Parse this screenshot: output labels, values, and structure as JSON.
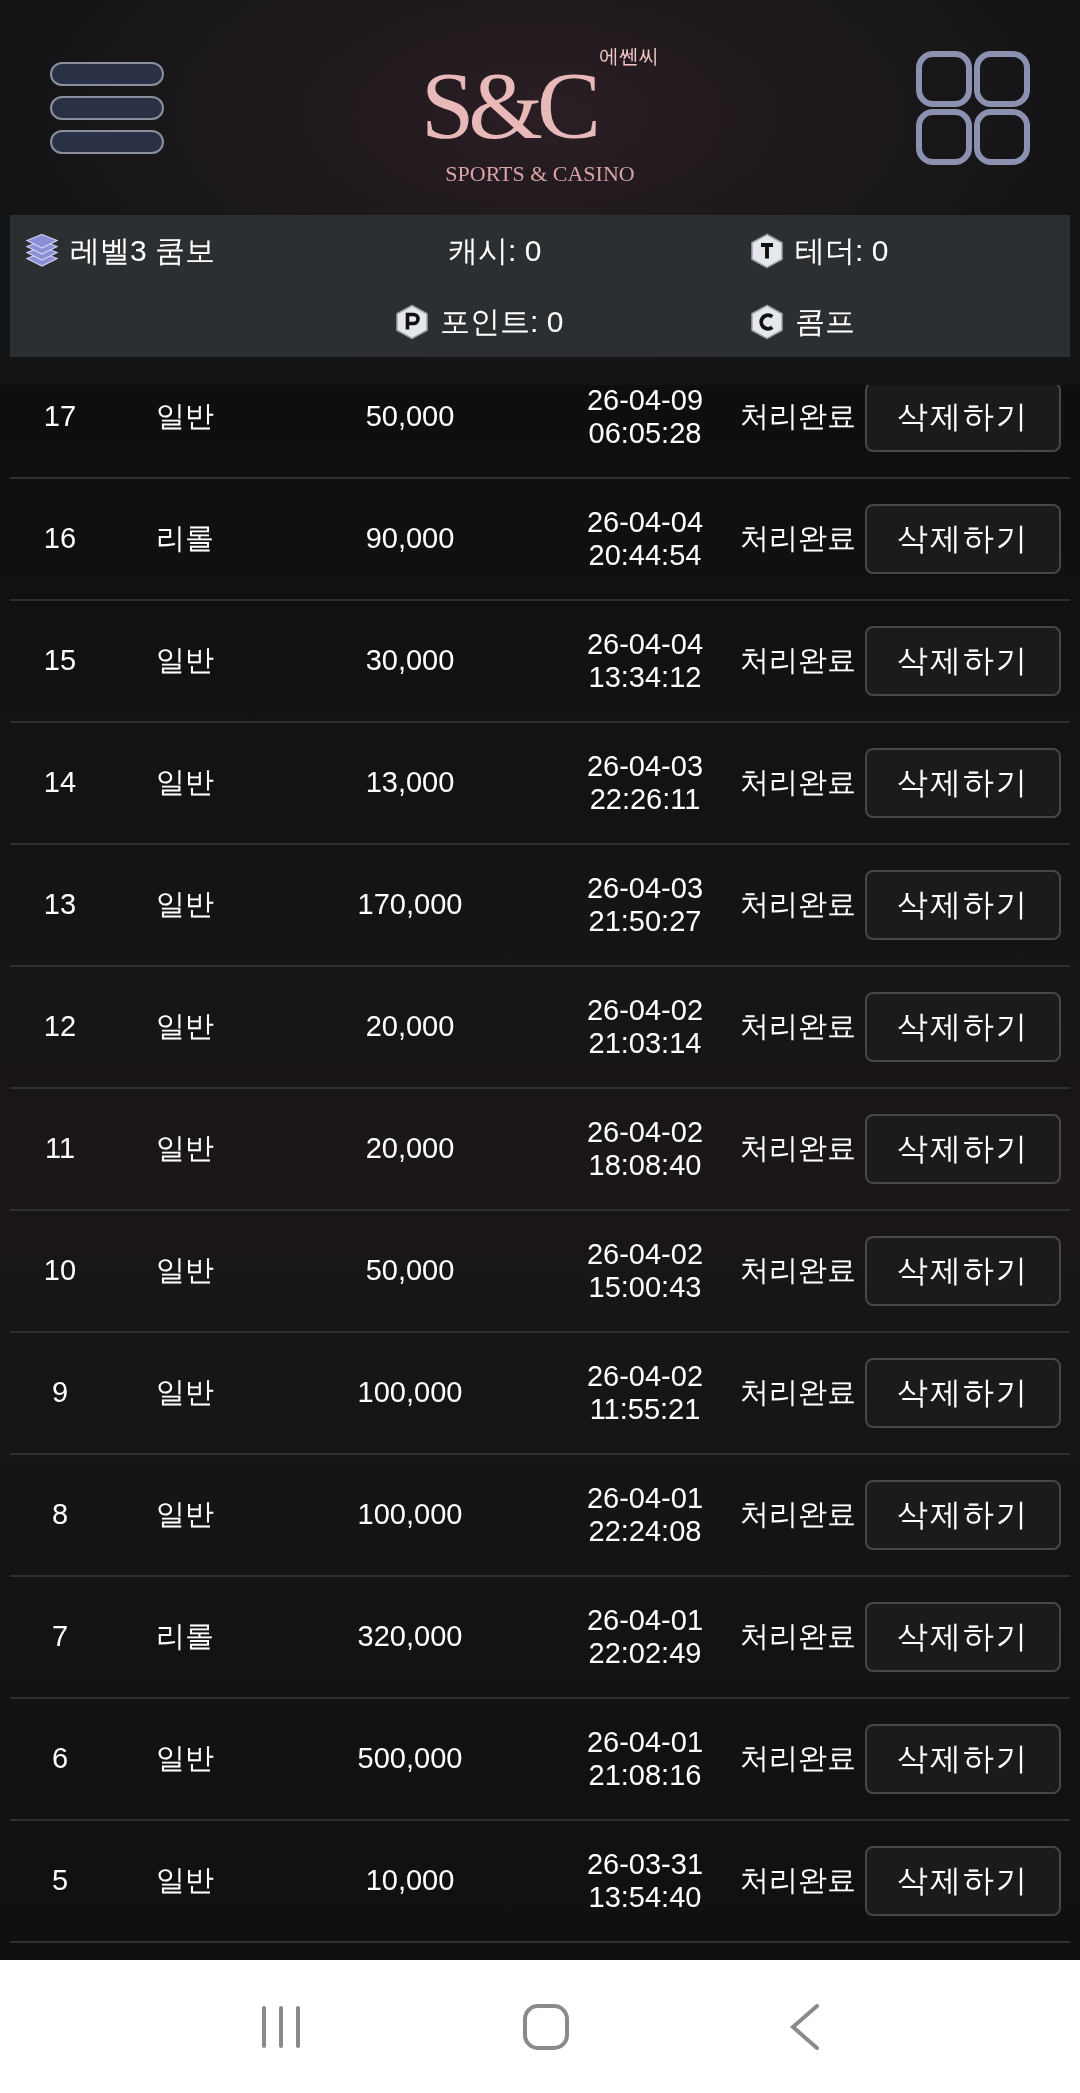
{
  "logo": {
    "mark": "S&C",
    "korean": "에쎈씨",
    "tagline": "SPORTS & CASINO"
  },
  "info": {
    "level": "레벨3 쿰보",
    "cash": "캐시: 0",
    "tether": "테더: 0",
    "point": "포인트: 0",
    "comp": "콤프"
  },
  "rows": [
    {
      "no": "17",
      "type": "일반",
      "amount": "50,000",
      "date": "26-04-09",
      "time": "06:05:28",
      "status": "처리완료",
      "action": "삭제하기"
    },
    {
      "no": "16",
      "type": "리롤",
      "amount": "90,000",
      "date": "26-04-04",
      "time": "20:44:54",
      "status": "처리완료",
      "action": "삭제하기"
    },
    {
      "no": "15",
      "type": "일반",
      "amount": "30,000",
      "date": "26-04-04",
      "time": "13:34:12",
      "status": "처리완료",
      "action": "삭제하기"
    },
    {
      "no": "14",
      "type": "일반",
      "amount": "13,000",
      "date": "26-04-03",
      "time": "22:26:11",
      "status": "처리완료",
      "action": "삭제하기"
    },
    {
      "no": "13",
      "type": "일반",
      "amount": "170,000",
      "date": "26-04-03",
      "time": "21:50:27",
      "status": "처리완료",
      "action": "삭제하기"
    },
    {
      "no": "12",
      "type": "일반",
      "amount": "20,000",
      "date": "26-04-02",
      "time": "21:03:14",
      "status": "처리완료",
      "action": "삭제하기"
    },
    {
      "no": "11",
      "type": "일반",
      "amount": "20,000",
      "date": "26-04-02",
      "time": "18:08:40",
      "status": "처리완료",
      "action": "삭제하기"
    },
    {
      "no": "10",
      "type": "일반",
      "amount": "50,000",
      "date": "26-04-02",
      "time": "15:00:43",
      "status": "처리완료",
      "action": "삭제하기"
    },
    {
      "no": "9",
      "type": "일반",
      "amount": "100,000",
      "date": "26-04-02",
      "time": "11:55:21",
      "status": "처리완료",
      "action": "삭제하기"
    },
    {
      "no": "8",
      "type": "일반",
      "amount": "100,000",
      "date": "26-04-01",
      "time": "22:24:08",
      "status": "처리완료",
      "action": "삭제하기"
    },
    {
      "no": "7",
      "type": "리롤",
      "amount": "320,000",
      "date": "26-04-01",
      "time": "22:02:49",
      "status": "처리완료",
      "action": "삭제하기"
    },
    {
      "no": "6",
      "type": "일반",
      "amount": "500,000",
      "date": "26-04-01",
      "time": "21:08:16",
      "status": "처리완료",
      "action": "삭제하기"
    },
    {
      "no": "5",
      "type": "일반",
      "amount": "10,000",
      "date": "26-03-31",
      "time": "13:54:40",
      "status": "처리완료",
      "action": "삭제하기"
    }
  ]
}
